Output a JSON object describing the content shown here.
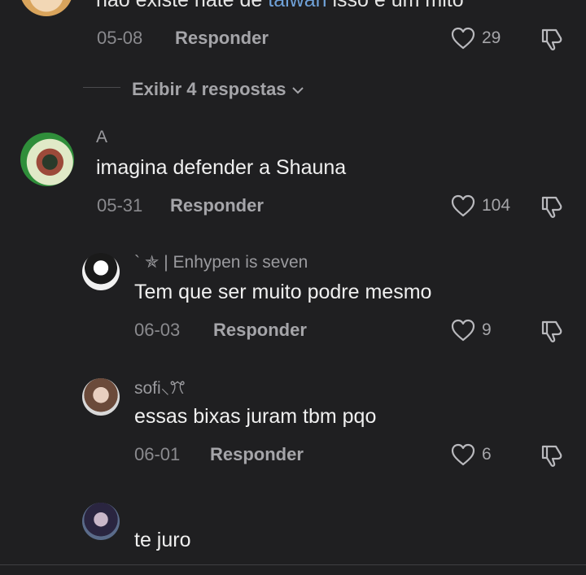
{
  "comments": [
    {
      "text_prefix": "não existe hate de ",
      "text_link": "taiwan",
      "text_suffix": "  isso é um mito",
      "date": "05-08",
      "reply_label": "Responder",
      "likes": "29"
    },
    {
      "username": "A",
      "text": "imagina defender a Shauna",
      "date": "05-31",
      "reply_label": "Responder",
      "likes": "104",
      "view_replies": "Exibir 4 respostas"
    }
  ],
  "replies": [
    {
      "username": "` ✯ | Enhypen is seven",
      "text": "Tem que ser muito podre mesmo",
      "date": "06-03",
      "reply_label": "Responder",
      "likes": "9"
    },
    {
      "username": "sofi⸜ꔫ",
      "text": "essas bixas juram tbm pqo",
      "date": "06-01",
      "reply_label": "Responder",
      "likes": "6"
    },
    {
      "text": "te juro"
    }
  ],
  "colors": {
    "background": "#1f1f21",
    "link": "#6fa1d8",
    "meta": "#8a8a8e"
  },
  "icons": [
    "heart-icon",
    "dislike-icon",
    "chevron-down-icon"
  ]
}
